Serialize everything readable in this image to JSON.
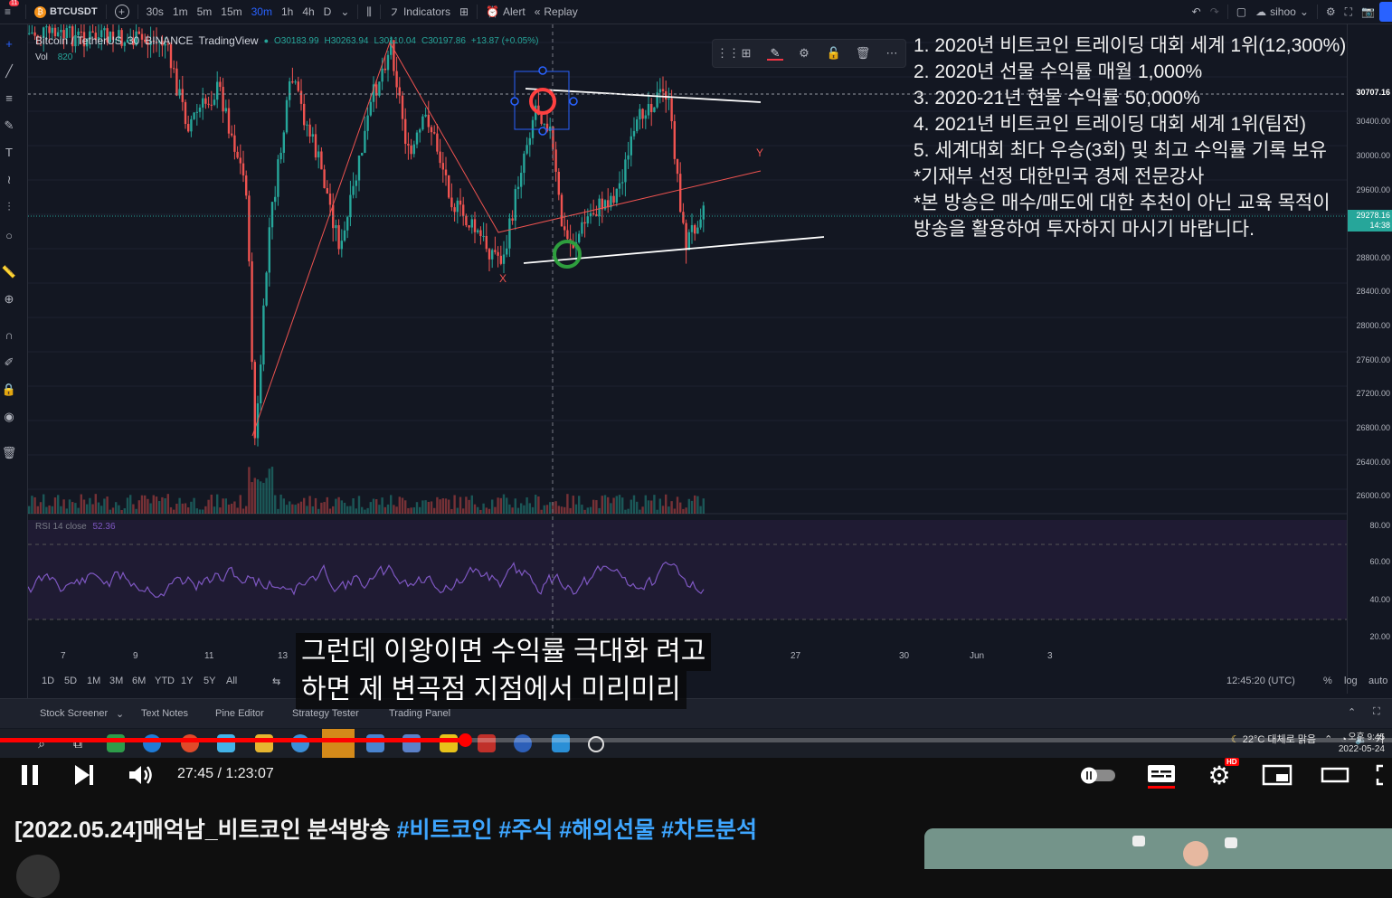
{
  "topbar": {
    "symbol": "BTCUSDT",
    "notification_count": "11",
    "intervals": [
      "30s",
      "1m",
      "5m",
      "15m",
      "30m",
      "1h",
      "4h",
      "D"
    ],
    "active_interval": "30m",
    "indicators_label": "Indicators",
    "alert_label": "Alert",
    "replay_label": "Replay",
    "user_label": "sihoo"
  },
  "legend": {
    "pair": "Bitcoin / TetherUS",
    "interval": "30",
    "exchange": "BINANCE",
    "source": "TradingView",
    "o": "O30183.99",
    "h": "H30263.94",
    "l": "L30110.04",
    "c": "C30197.86",
    "change": "+13.87 (+0.05%)",
    "vol_label": "Vol",
    "vol_value": "820",
    "rsi_label": "RSI 14 close",
    "rsi_value": "52.36"
  },
  "price_scale": {
    "labels": [
      "30400.00",
      "30000.00",
      "29600.00",
      "29200.00",
      "28800.00",
      "28400.00",
      "28000.00",
      "27600.00",
      "27200.00",
      "26800.00",
      "26400.00",
      "26000.00"
    ],
    "current_price": "30707.16",
    "crosshair_price": "29278.16",
    "crosshair_time": "14:38",
    "rsi_labels": [
      "80.00",
      "60.00",
      "40.00",
      "20.00"
    ]
  },
  "time_axis": {
    "ticks": [
      "7",
      "9",
      "11",
      "13",
      "27",
      "30",
      "Jun",
      "3"
    ]
  },
  "range_bar": {
    "ranges": [
      "1D",
      "5D",
      "1M",
      "3M",
      "6M",
      "YTD",
      "1Y",
      "5Y",
      "All"
    ],
    "clock": "12:45:20 (UTC)",
    "percent": "%",
    "log": "log",
    "auto": "auto"
  },
  "bottom_panel": {
    "tabs": [
      "Stock Screener",
      "Text Notes",
      "Pine Editor",
      "Strategy Tester",
      "Trading Panel"
    ]
  },
  "chart_marks": {
    "x_label": "X",
    "y_label": "Y"
  },
  "overlay_text": [
    "1. 2020년 비트코인 트레이딩 대회 세계 1위(12,300%)",
    "2. 2020년 선물 수익률 매월 1,000%",
    "3. 2020-21년 현물 수익률 50,000%",
    "4. 2021년 비트코인 트레이딩 대회 세계 1위(팀전)",
    "5. 세계대회 최다 우승(3회) 및 최고 수익률 기록 보유",
    "*기재부 선정 대한민국 경제 전문강사",
    "*본 방송은 매수/매도에 대한 추천이 아닌 교육 목적이",
    " 방송을 활용하여 투자하지 마시기 바랍니다."
  ],
  "subtitle": {
    "line1": "그런데 이왕이면 수익률 극대화 려고",
    "line2": "하면 제 변곡점 지점에서 미리미리"
  },
  "taskbar": {
    "weather": "22°C 대체로 맑음",
    "time": "오후 9:45",
    "date": "2022-05-24"
  },
  "player": {
    "time_display": "27:45 / 1:23:07",
    "progress_fraction": 0.334,
    "hd_badge": "HD"
  },
  "video": {
    "title_plain": "[2022.05.24]매억남_비트코인 분석방송 ",
    "hashtags": "#비트코인 #주식 #해외선물 #차트분석"
  },
  "colors": {
    "up": "#26a69a",
    "down": "#ef5350",
    "rsi_line": "#7e57c2",
    "accent": "#2962ff",
    "progress": "#ff0000",
    "hashtag": "#3ea6ff"
  }
}
